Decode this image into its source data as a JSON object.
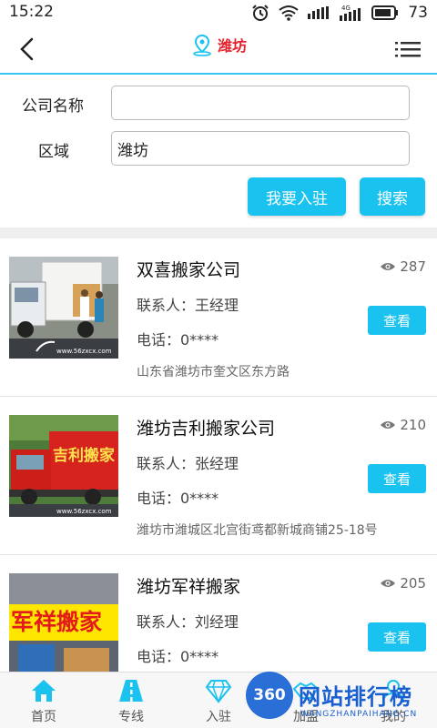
{
  "status_bar": {
    "time": "15:22",
    "battery": "73",
    "network": "4G"
  },
  "nav": {
    "title": "潍坊"
  },
  "form": {
    "company_label": "公司名称",
    "company_value": "",
    "region_label": "区域",
    "region_value": "潍坊",
    "join_label": "我要入驻",
    "search_label": "搜索"
  },
  "listings": [
    {
      "name": "双喜搬家公司",
      "views": "287",
      "contact": "联系人：王经理",
      "phone": "电话：0****",
      "address": "山东省潍坊市奎文区东方路",
      "view_label": "查看",
      "photo_caption": "www.56zxcx.com"
    },
    {
      "name": "潍坊吉利搬家公司",
      "views": "210",
      "contact": "联系人：张经理",
      "phone": "电话：0****",
      "address": "潍坊市潍城区北宫街鸢都新城商铺25-18号",
      "view_label": "查看",
      "photo_sign": "吉利搬家",
      "photo_caption": "www.56zxcx.com"
    },
    {
      "name": "潍坊军祥搬家",
      "views": "205",
      "contact": "联系人：刘经理",
      "phone": "电话：0****",
      "address": "",
      "view_label": "查看",
      "photo_sign": "军祥搬家"
    }
  ],
  "tabs": [
    {
      "label": "首页",
      "icon": "home-icon"
    },
    {
      "label": "专线",
      "icon": "road-icon"
    },
    {
      "label": "入驻",
      "icon": "diamond-icon"
    },
    {
      "label": "加盟",
      "icon": "handshake-icon"
    },
    {
      "label": "我的",
      "icon": "user-icon"
    }
  ],
  "watermark": {
    "logo": "360",
    "title": "网站排行榜",
    "subtitle": "WANGZHANPAIHANG.CN"
  },
  "colors": {
    "accent": "#1ac2ef",
    "title_red": "#e4212b",
    "nav_border": "#38c4ee"
  }
}
